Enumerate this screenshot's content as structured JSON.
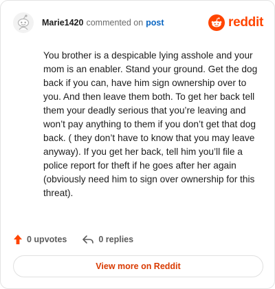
{
  "header": {
    "username": "Marie1420",
    "action_text": "commented on",
    "post_link_label": "post",
    "brand_name": "reddit"
  },
  "comment": {
    "body": "You brother is a despicable lying asshole and your mom is an enabler. Stand your ground. Get the dog back if you can, have him sign ownership over to you. And then leave them both. To get her back tell them your deadly serious that you’re leaving and won’t pay anything to them if you don’t get that dog back. ( they don’t have to know that you may leave anyway). If you get her back, tell him you’ll file a police report for theft if he goes after her again (obviously need him to sign over ownership for this threat)."
  },
  "actions": {
    "upvotes_label": "0 upvotes",
    "replies_label": "0 replies"
  },
  "footer": {
    "view_more_label": "View more on Reddit"
  },
  "colors": {
    "brand": "#ff4500",
    "link": "#0a66c2",
    "cta_text": "#d93a00",
    "upvote_icon": "#ff4500",
    "muted_text": "#5c5c5c"
  },
  "icons": {
    "avatar": "snoo-avatar-icon",
    "brand": "reddit-logo-icon",
    "upvote": "upvote-arrow-icon",
    "reply": "reply-arrow-icon"
  }
}
